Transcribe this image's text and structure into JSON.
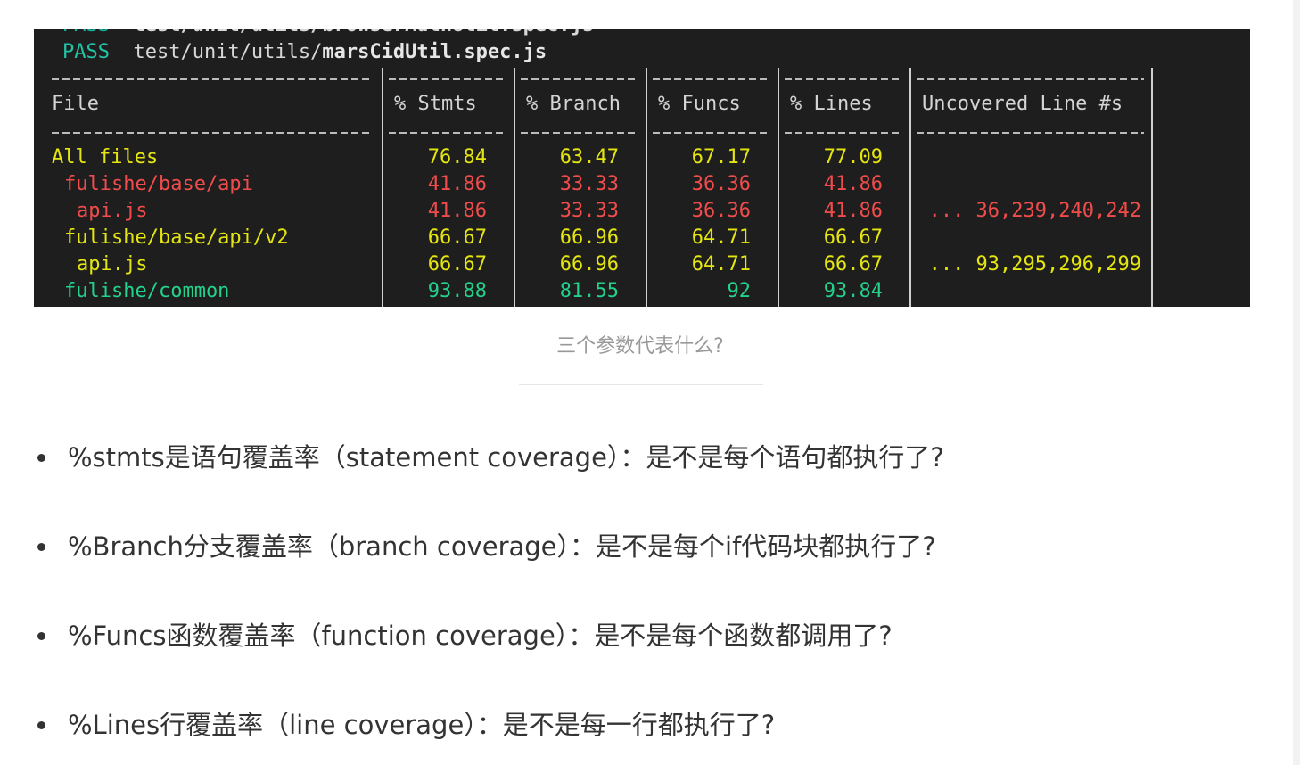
{
  "terminal": {
    "clipped_line": {
      "pass": "PASS",
      "text": "test/unit/utils/browserAuthUtil.spec.js"
    },
    "pass_line": {
      "pass": "PASS",
      "path": "test/unit/utils/",
      "file": "marsCidUtil.spec.js"
    },
    "headers": [
      "File",
      "% Stmts",
      "% Branch",
      "% Funcs",
      "% Lines",
      "Uncovered Line #s"
    ],
    "rows": [
      {
        "file": "All files",
        "stmts": "76.84",
        "branch": "63.47",
        "funcs": "67.17",
        "lines": "77.09",
        "uncovered": "",
        "color": "yellow"
      },
      {
        "file": "fulishe/base/api",
        "stmts": "41.86",
        "branch": "33.33",
        "funcs": "36.36",
        "lines": "41.86",
        "uncovered": "",
        "color": "red"
      },
      {
        "file": "api.js",
        "stmts": "41.86",
        "branch": "33.33",
        "funcs": "36.36",
        "lines": "41.86",
        "uncovered": "... 36,239,240,242",
        "color": "red"
      },
      {
        "file": "fulishe/base/api/v2",
        "stmts": "66.67",
        "branch": "66.96",
        "funcs": "64.71",
        "lines": "66.67",
        "uncovered": "",
        "color": "yellow"
      },
      {
        "file": "api.js",
        "stmts": "66.67",
        "branch": "66.96",
        "funcs": "64.71",
        "lines": "66.67",
        "uncovered": "... 93,295,296,299",
        "color": "yellow"
      },
      {
        "file": "fulishe/common",
        "stmts": "93.88",
        "branch": "81.55",
        "funcs": "92",
        "lines": "93.84",
        "uncovered": "",
        "color": "green"
      }
    ]
  },
  "caption": "三个参数代表什么?",
  "bullets": [
    "%stmts是语句覆盖率（statement coverage）：是不是每个语句都执行了?",
    "%Branch分支覆盖率（branch coverage）：是不是每个if代码块都执行了?",
    "%Funcs函数覆盖率（function coverage）：是不是每个函数都调用了?",
    "%Lines行覆盖率（line coverage）：是不是每一行都执行了?"
  ],
  "colors": {
    "terminal_bg": "#1e1e1e",
    "yellow": "#e5e510",
    "red": "#f14c4c",
    "green": "#23d18b",
    "pass": "#22c3a5"
  }
}
